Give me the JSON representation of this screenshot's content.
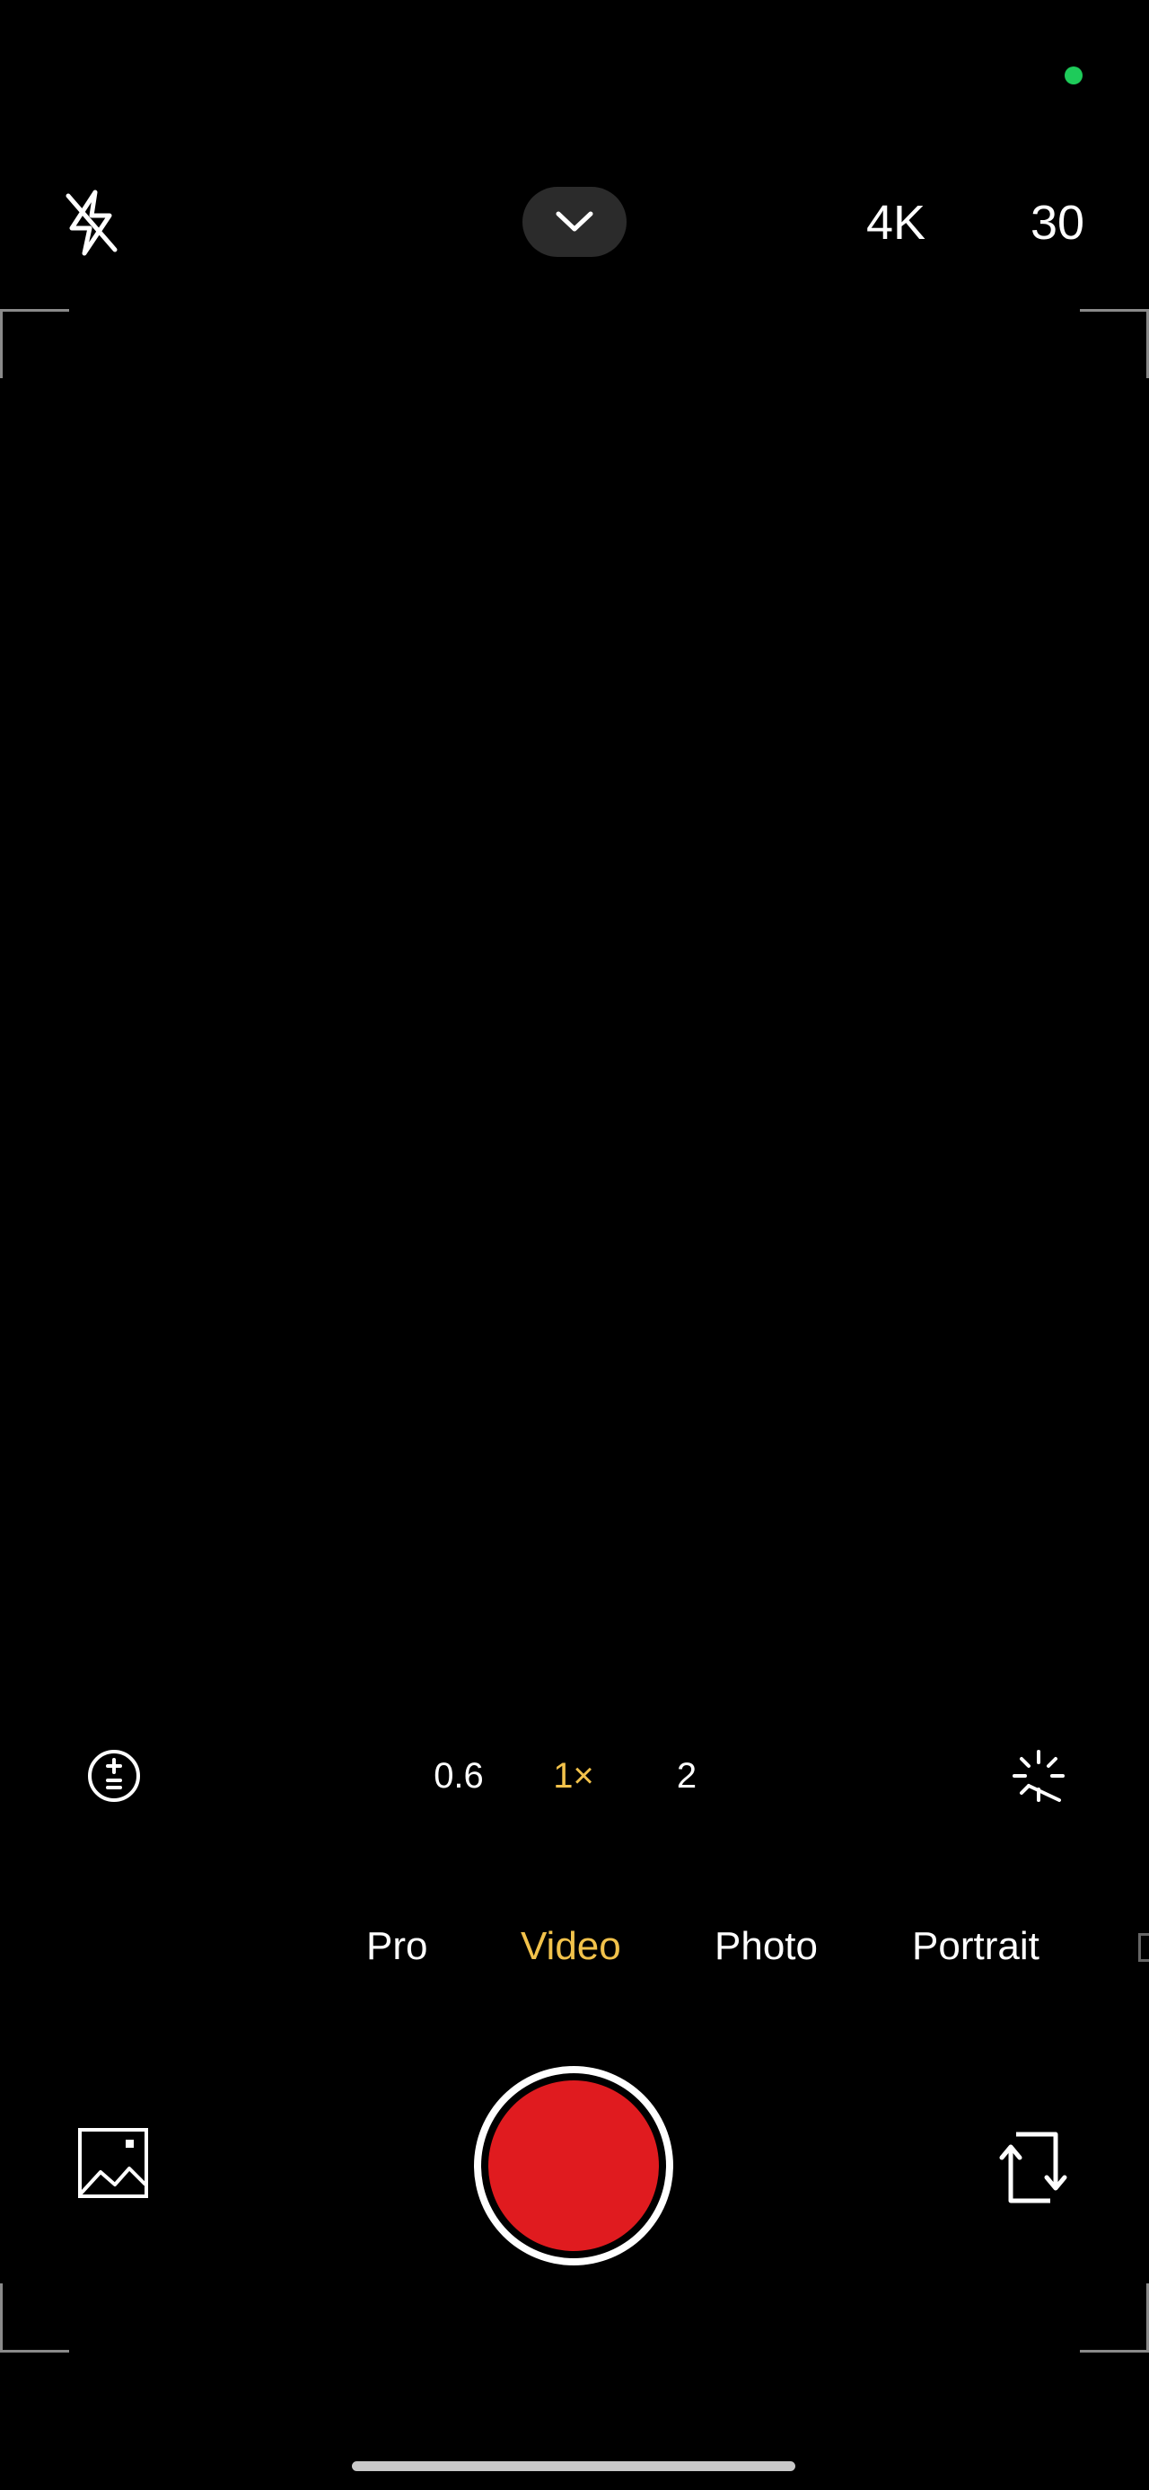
{
  "status": {
    "privacy_indicator_color": "#1ecb5a"
  },
  "top_bar": {
    "flash_icon": "flash-off-icon",
    "collapse_icon": "chevron-down-icon",
    "resolution": "4K",
    "frame_rate": "30"
  },
  "zoom": {
    "exposure_icon": "exposure-compensation-icon",
    "levels": [
      "0.6",
      "1×",
      "2"
    ],
    "selected": "1×",
    "filter_icon": "magic-wand-icon"
  },
  "modes": {
    "items": [
      "Pro",
      "Video",
      "Photo",
      "Portrait"
    ],
    "selected": "Video"
  },
  "bottom_bar": {
    "gallery_icon": "gallery-icon",
    "shutter_color": "#e01b1f",
    "flip_icon": "switch-camera-icon"
  },
  "colors": {
    "accent": "#f2c24b",
    "background": "#000000",
    "text": "#ffffff"
  }
}
